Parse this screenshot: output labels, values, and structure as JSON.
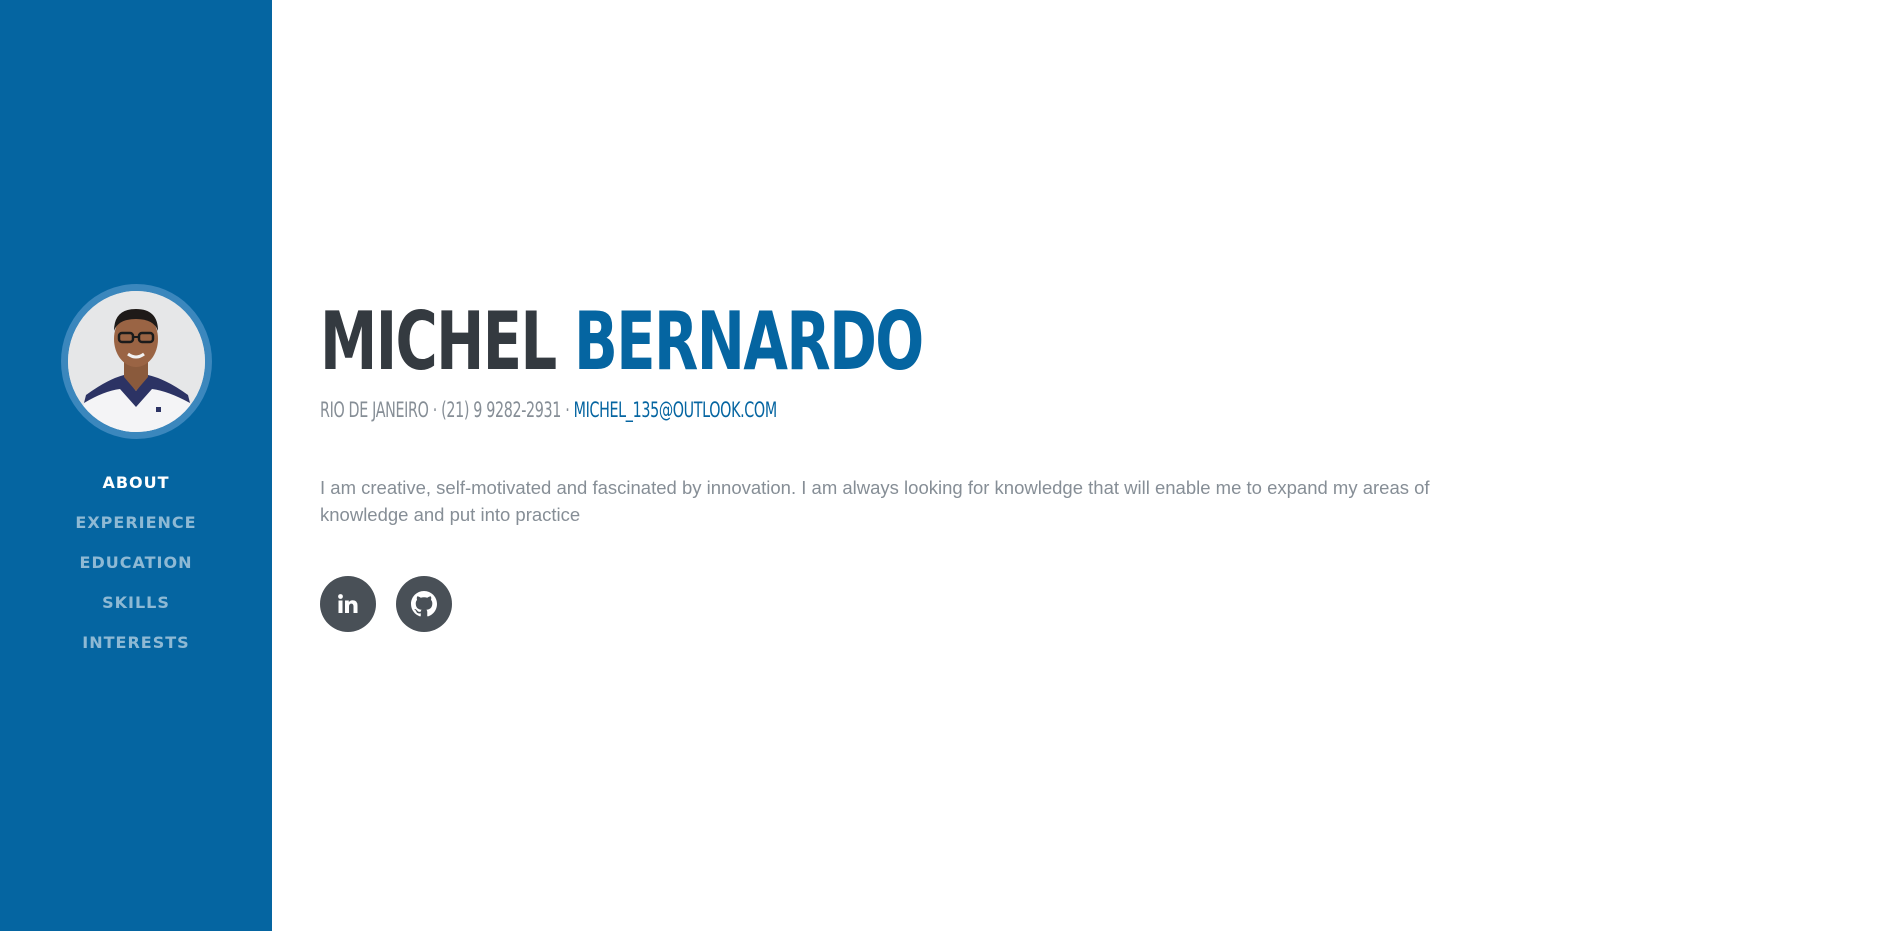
{
  "profile": {
    "first_name": "MICHEL",
    "last_name": "BERNARDO",
    "location": "RIO DE JANEIRO",
    "phone": "(21) 9 9282-2931",
    "email": "MICHEL_135@OUTLOOK.COM",
    "separator": " · ",
    "bio": "I am creative, self-motivated and fascinated by innovation. I am always looking for knowledge that will enable me to expand my areas of knowledge and put into practice"
  },
  "sidebar": {
    "nav": [
      {
        "label": "About",
        "active": true
      },
      {
        "label": "Experience",
        "active": false
      },
      {
        "label": "Education",
        "active": false
      },
      {
        "label": "Skills",
        "active": false
      },
      {
        "label": "Interests",
        "active": false
      }
    ]
  },
  "social": [
    {
      "icon": "linkedin-icon"
    },
    {
      "icon": "github-icon"
    }
  ],
  "colors": {
    "primary": "#0565a1",
    "dark": "#343a40",
    "muted": "#868e96",
    "social_bg": "#495057"
  }
}
